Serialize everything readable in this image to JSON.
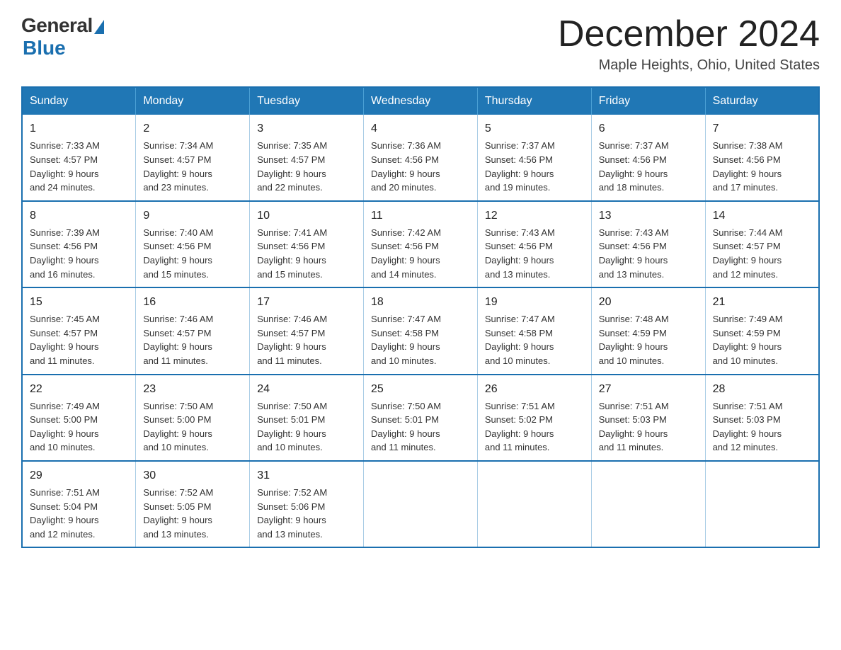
{
  "logo": {
    "general": "General",
    "blue": "Blue"
  },
  "header": {
    "month": "December 2024",
    "location": "Maple Heights, Ohio, United States"
  },
  "weekdays": [
    "Sunday",
    "Monday",
    "Tuesday",
    "Wednesday",
    "Thursday",
    "Friday",
    "Saturday"
  ],
  "weeks": [
    [
      {
        "day": "1",
        "sunrise": "7:33 AM",
        "sunset": "4:57 PM",
        "daylight": "9 hours and 24 minutes."
      },
      {
        "day": "2",
        "sunrise": "7:34 AM",
        "sunset": "4:57 PM",
        "daylight": "9 hours and 23 minutes."
      },
      {
        "day": "3",
        "sunrise": "7:35 AM",
        "sunset": "4:57 PM",
        "daylight": "9 hours and 22 minutes."
      },
      {
        "day": "4",
        "sunrise": "7:36 AM",
        "sunset": "4:56 PM",
        "daylight": "9 hours and 20 minutes."
      },
      {
        "day": "5",
        "sunrise": "7:37 AM",
        "sunset": "4:56 PM",
        "daylight": "9 hours and 19 minutes."
      },
      {
        "day": "6",
        "sunrise": "7:37 AM",
        "sunset": "4:56 PM",
        "daylight": "9 hours and 18 minutes."
      },
      {
        "day": "7",
        "sunrise": "7:38 AM",
        "sunset": "4:56 PM",
        "daylight": "9 hours and 17 minutes."
      }
    ],
    [
      {
        "day": "8",
        "sunrise": "7:39 AM",
        "sunset": "4:56 PM",
        "daylight": "9 hours and 16 minutes."
      },
      {
        "day": "9",
        "sunrise": "7:40 AM",
        "sunset": "4:56 PM",
        "daylight": "9 hours and 15 minutes."
      },
      {
        "day": "10",
        "sunrise": "7:41 AM",
        "sunset": "4:56 PM",
        "daylight": "9 hours and 15 minutes."
      },
      {
        "day": "11",
        "sunrise": "7:42 AM",
        "sunset": "4:56 PM",
        "daylight": "9 hours and 14 minutes."
      },
      {
        "day": "12",
        "sunrise": "7:43 AM",
        "sunset": "4:56 PM",
        "daylight": "9 hours and 13 minutes."
      },
      {
        "day": "13",
        "sunrise": "7:43 AM",
        "sunset": "4:56 PM",
        "daylight": "9 hours and 13 minutes."
      },
      {
        "day": "14",
        "sunrise": "7:44 AM",
        "sunset": "4:57 PM",
        "daylight": "9 hours and 12 minutes."
      }
    ],
    [
      {
        "day": "15",
        "sunrise": "7:45 AM",
        "sunset": "4:57 PM",
        "daylight": "9 hours and 11 minutes."
      },
      {
        "day": "16",
        "sunrise": "7:46 AM",
        "sunset": "4:57 PM",
        "daylight": "9 hours and 11 minutes."
      },
      {
        "day": "17",
        "sunrise": "7:46 AM",
        "sunset": "4:57 PM",
        "daylight": "9 hours and 11 minutes."
      },
      {
        "day": "18",
        "sunrise": "7:47 AM",
        "sunset": "4:58 PM",
        "daylight": "9 hours and 10 minutes."
      },
      {
        "day": "19",
        "sunrise": "7:47 AM",
        "sunset": "4:58 PM",
        "daylight": "9 hours and 10 minutes."
      },
      {
        "day": "20",
        "sunrise": "7:48 AM",
        "sunset": "4:59 PM",
        "daylight": "9 hours and 10 minutes."
      },
      {
        "day": "21",
        "sunrise": "7:49 AM",
        "sunset": "4:59 PM",
        "daylight": "9 hours and 10 minutes."
      }
    ],
    [
      {
        "day": "22",
        "sunrise": "7:49 AM",
        "sunset": "5:00 PM",
        "daylight": "9 hours and 10 minutes."
      },
      {
        "day": "23",
        "sunrise": "7:50 AM",
        "sunset": "5:00 PM",
        "daylight": "9 hours and 10 minutes."
      },
      {
        "day": "24",
        "sunrise": "7:50 AM",
        "sunset": "5:01 PM",
        "daylight": "9 hours and 10 minutes."
      },
      {
        "day": "25",
        "sunrise": "7:50 AM",
        "sunset": "5:01 PM",
        "daylight": "9 hours and 11 minutes."
      },
      {
        "day": "26",
        "sunrise": "7:51 AM",
        "sunset": "5:02 PM",
        "daylight": "9 hours and 11 minutes."
      },
      {
        "day": "27",
        "sunrise": "7:51 AM",
        "sunset": "5:03 PM",
        "daylight": "9 hours and 11 minutes."
      },
      {
        "day": "28",
        "sunrise": "7:51 AM",
        "sunset": "5:03 PM",
        "daylight": "9 hours and 12 minutes."
      }
    ],
    [
      {
        "day": "29",
        "sunrise": "7:51 AM",
        "sunset": "5:04 PM",
        "daylight": "9 hours and 12 minutes."
      },
      {
        "day": "30",
        "sunrise": "7:52 AM",
        "sunset": "5:05 PM",
        "daylight": "9 hours and 13 minutes."
      },
      {
        "day": "31",
        "sunrise": "7:52 AM",
        "sunset": "5:06 PM",
        "daylight": "9 hours and 13 minutes."
      },
      null,
      null,
      null,
      null
    ]
  ],
  "labels": {
    "sunrise": "Sunrise:",
    "sunset": "Sunset:",
    "daylight": "Daylight:"
  }
}
